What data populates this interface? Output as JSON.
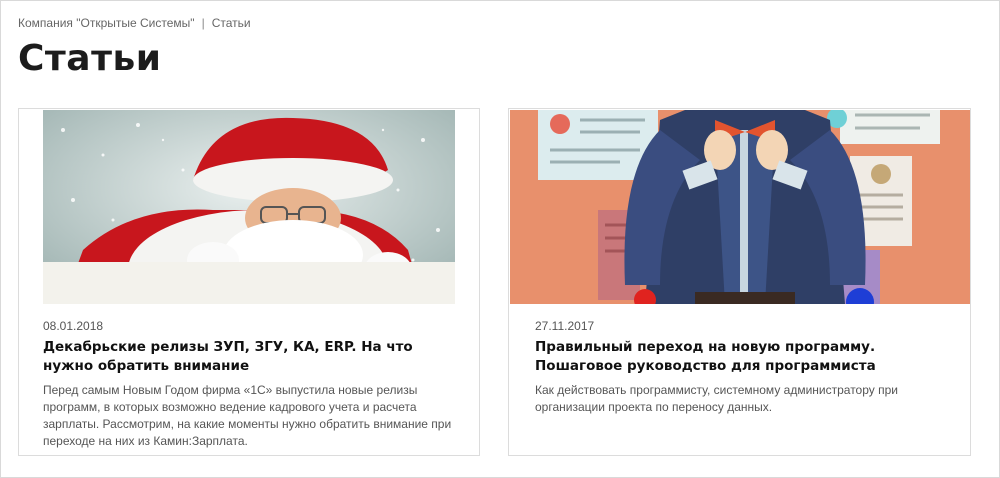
{
  "breadcrumb": {
    "items": [
      "Компания \"Открытые Системы\"",
      "Статьи"
    ],
    "separator": "|"
  },
  "page": {
    "title": "Статьи"
  },
  "articles": [
    {
      "image_icon": "santa-claus-illustration",
      "date": "08.01.2018",
      "title": "Декабрьские релизы ЗУП, ЗГУ, КА, ERP. На что нужно обратить внимание",
      "excerpt": "Перед самым Новым Годом фирма «1С» выпустила новые релизы программ, в которых возможно ведение кадрового учета и расчета зарплаты. Рассмотрим, на какие моменты нужно обратить внимание при переходе на них из Камин:Зарплата."
    },
    {
      "image_icon": "programmer-illustration",
      "date": "27.11.2017",
      "title": "Правильный переход на новую программу. Пошаговое руководство для программиста",
      "excerpt": "Как действовать программисту, системному администратору при организации проекта по переносу данных."
    }
  ],
  "colors": {
    "title": "#1c1c1c",
    "text_muted": "#555555",
    "border": "#dcdcdc",
    "santa_red": "#c8161d",
    "bg_orange": "#e8906c",
    "jacket_navy": "#2f3f66"
  }
}
